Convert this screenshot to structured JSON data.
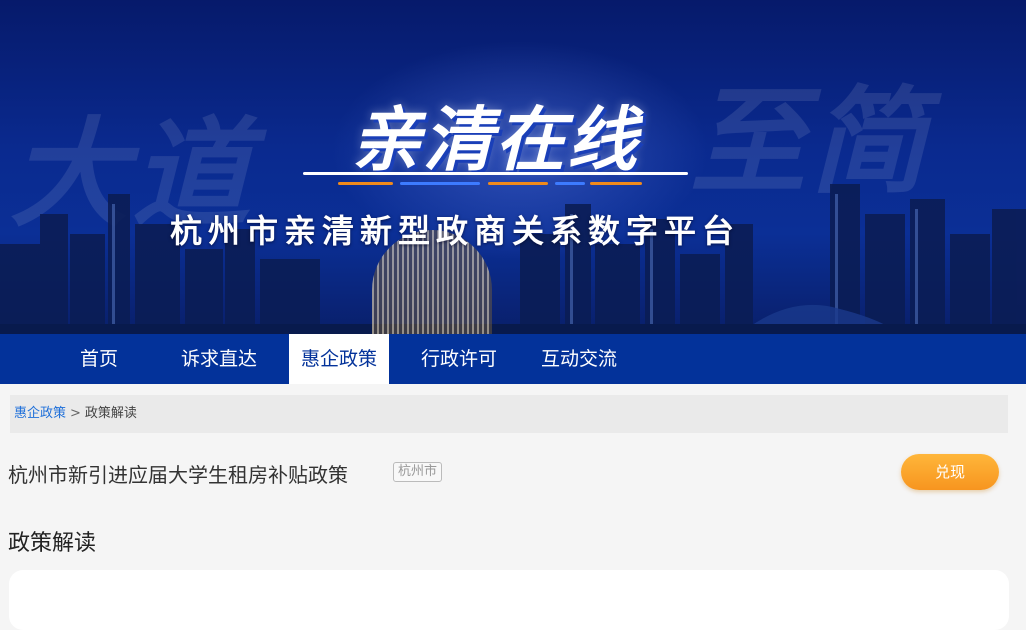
{
  "banner": {
    "logo_text": "亲清在线",
    "subtitle": "杭州市亲清新型政商关系数字平台",
    "ghost_left": "大道",
    "ghost_right": "至简",
    "colors": {
      "background": "#0a2a8f",
      "accent_orange": "#f08a1c",
      "accent_blue": "#3d7bff"
    }
  },
  "nav": {
    "items": [
      {
        "label": "首页",
        "active": false
      },
      {
        "label": "诉求直达",
        "active": false
      },
      {
        "label": "惠企政策",
        "active": true
      },
      {
        "label": "行政许可",
        "active": false
      },
      {
        "label": "互动交流",
        "active": false
      }
    ],
    "colors": {
      "background": "#03329a",
      "active_bg": "#ffffff"
    }
  },
  "breadcrumb": {
    "link": "惠企政策",
    "separator": ">",
    "current": "政策解读"
  },
  "policy": {
    "title": "杭州市新引进应届大学生租房补贴政策",
    "region_tag": "杭州市",
    "action_button": "兑现"
  },
  "section": {
    "title": "政策解读"
  }
}
